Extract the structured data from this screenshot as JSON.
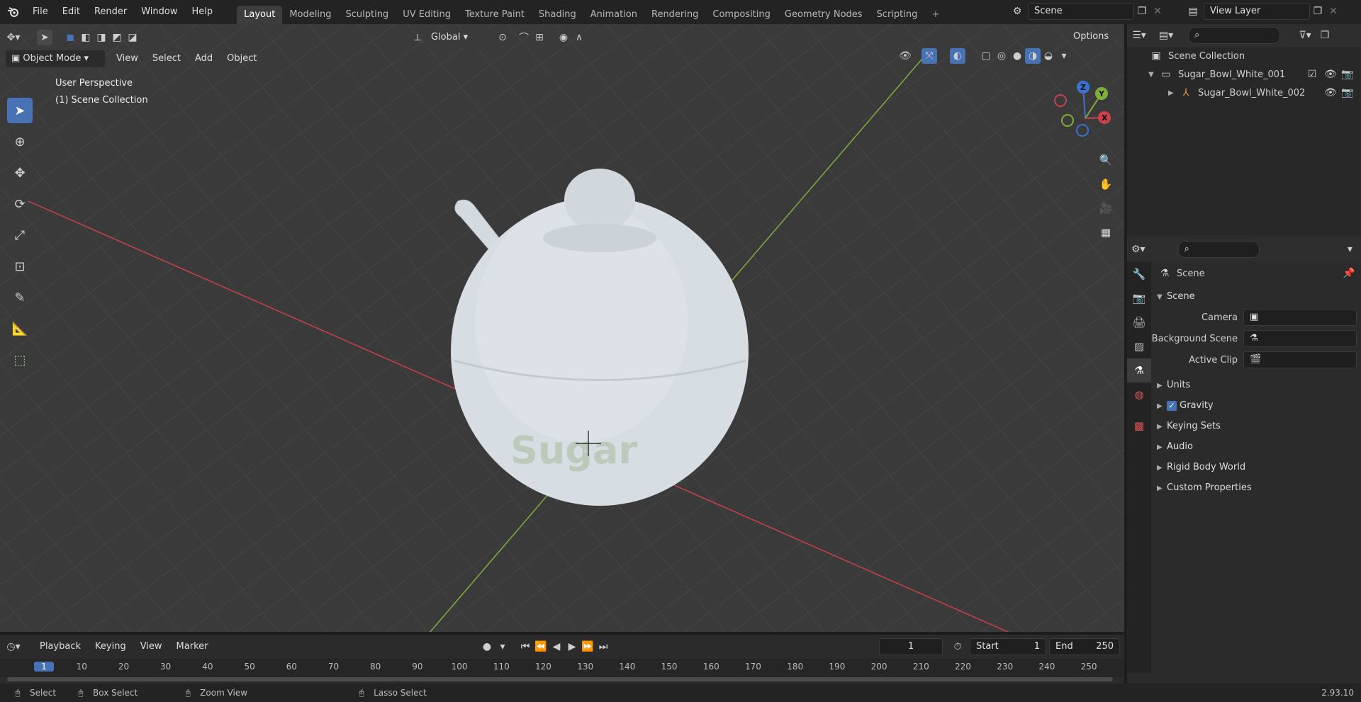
{
  "topbar": {
    "menus": [
      "File",
      "Edit",
      "Render",
      "Window",
      "Help"
    ],
    "workspaces": [
      "Layout",
      "Modeling",
      "Sculpting",
      "UV Editing",
      "Texture Paint",
      "Shading",
      "Animation",
      "Rendering",
      "Compositing",
      "Geometry Nodes",
      "Scripting"
    ],
    "active_workspace": "Layout",
    "scene_name": "Scene",
    "view_layer": "View Layer"
  },
  "viewport": {
    "mode": "Object Mode",
    "menus": [
      "View",
      "Select",
      "Add",
      "Object"
    ],
    "transform_orientation": "Global",
    "options_label": "Options",
    "overlay_title": "User Perspective",
    "overlay_collection": "(1) Scene Collection",
    "object_label": "Sugar"
  },
  "outliner": {
    "root": "Scene Collection",
    "items": [
      {
        "name": "Sugar_Bowl_White_001",
        "type": "collection"
      },
      {
        "name": "Sugar_Bowl_White_002",
        "type": "object"
      }
    ]
  },
  "properties": {
    "context": "Scene",
    "panel_title": "Scene",
    "fields": [
      {
        "label": "Camera",
        "value": ""
      },
      {
        "label": "Background Scene",
        "value": ""
      },
      {
        "label": "Active Clip",
        "value": ""
      }
    ],
    "sections": [
      "Units",
      "Gravity",
      "Keying Sets",
      "Audio",
      "Rigid Body World",
      "Custom Properties"
    ],
    "gravity_checked": true
  },
  "timeline": {
    "menus": [
      "Playback",
      "Keying",
      "View",
      "Marker"
    ],
    "current_frame": "1",
    "start_label": "Start",
    "start_value": "1",
    "end_label": "End",
    "end_value": "250",
    "ticks": [
      "1",
      "10",
      "20",
      "30",
      "40",
      "50",
      "60",
      "70",
      "80",
      "90",
      "100",
      "110",
      "120",
      "130",
      "140",
      "150",
      "160",
      "170",
      "180",
      "190",
      "200",
      "210",
      "220",
      "230",
      "240",
      "250"
    ]
  },
  "statusbar": {
    "items": [
      "Select",
      "Box Select",
      "Zoom View",
      "Lasso Select"
    ],
    "version": "2.93.10"
  },
  "colors": {
    "accent": "#4772b3",
    "x_axis": "#c9414a",
    "y_axis": "#7fae3a",
    "z_axis": "#3a74d1"
  }
}
